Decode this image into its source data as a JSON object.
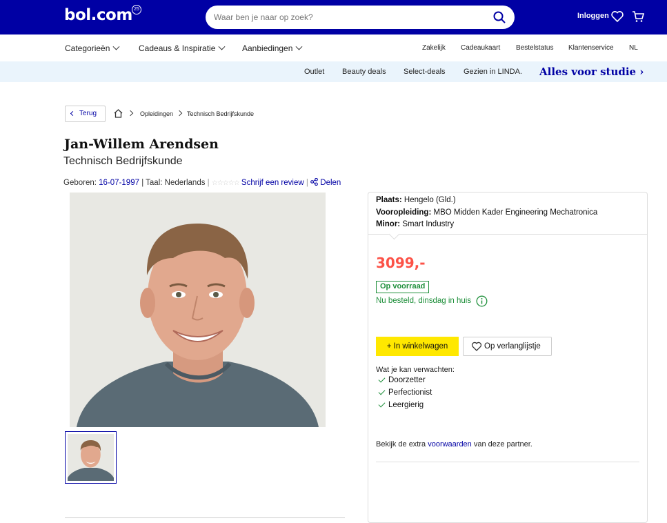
{
  "header": {
    "logo": "bol.com",
    "logo_badge": "25",
    "search_placeholder": "Waar ben je naar op zoek?",
    "login_label": "Inloggen"
  },
  "nav": {
    "left": [
      "Categorieën",
      "Cadeaus & Inspiratie",
      "Aanbiedingen"
    ],
    "right": [
      "Zakelijk",
      "Cadeaukaart",
      "Bestelstatus",
      "Klantenservice",
      "NL"
    ]
  },
  "promo": {
    "items": [
      "Outlet",
      "Beauty deals",
      "Select-deals",
      "Gezien in LINDA."
    ],
    "highlight": "Alles voor studie"
  },
  "breadcrumb": {
    "back_label": "Terug",
    "items": [
      "Opleidingen",
      "Technisch Bedrijfskunde"
    ]
  },
  "product": {
    "title": "Jan-Willem Arendsen",
    "subtitle": "Technisch Bedrijfskunde",
    "born_label": "Geboren:",
    "born_value": "16-07-1997",
    "language": "| Taal: Nederlands",
    "review_link": "Schrijf een review",
    "share_link": "Delen"
  },
  "offer": {
    "specs": [
      {
        "label": "Plaats:",
        "value": "Hengelo (Gld.)"
      },
      {
        "label": "Vooropleiding:",
        "value": "MBO Midden Kader Engineering Mechatronica"
      },
      {
        "label": "Minor:",
        "value": "Smart Industry"
      }
    ],
    "price": "3099,-",
    "stock": "Op voorraad",
    "delivery": "Nu besteld, dinsdag in huis",
    "cart_button": "+ In winkelwagen",
    "wishlist_button": "Op verlanglijstje",
    "expect_title": "Wat je kan verwachten:",
    "expect_items": [
      "Doorzetter",
      "Perfectionist",
      "Leergierig"
    ],
    "conditions_pre": "Bekijk de extra ",
    "conditions_link": "voorwaarden",
    "conditions_post": " van deze partner."
  },
  "colors": {
    "brand": "#0000a4",
    "price": "#fc5247",
    "stock": "#1e8f3a",
    "cart_button": "#ffe800"
  }
}
